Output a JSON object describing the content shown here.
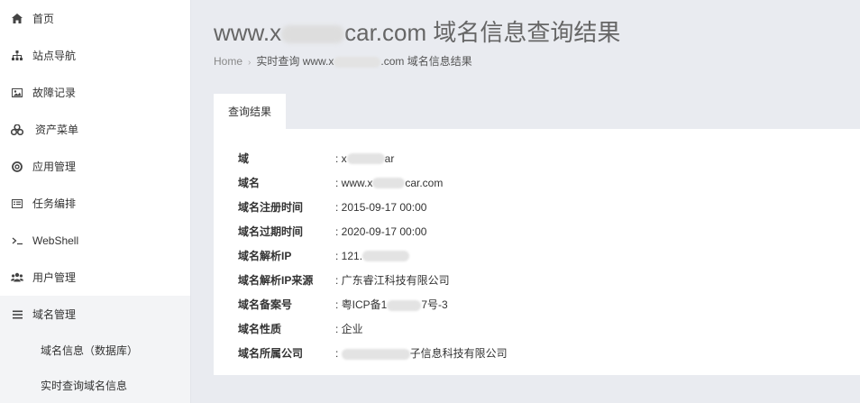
{
  "sidebar": {
    "items": [
      {
        "label": "首页",
        "icon": "home-icon"
      },
      {
        "label": "站点导航",
        "icon": "sitemap-icon"
      },
      {
        "label": "故障记录",
        "icon": "picture-icon"
      },
      {
        "label": "资产菜单",
        "icon": "cubes-icon"
      },
      {
        "label": "应用管理",
        "icon": "lifebuoy-icon"
      },
      {
        "label": "任务编排",
        "icon": "list-alt-icon"
      },
      {
        "label": "WebShell",
        "icon": "terminal-icon"
      },
      {
        "label": "用户管理",
        "icon": "users-icon"
      },
      {
        "label": "域名管理",
        "icon": "bars-icon"
      }
    ],
    "subitems": [
      {
        "label": "域名信息（数据库）"
      },
      {
        "label": "实时查询域名信息"
      }
    ]
  },
  "header": {
    "title_prefix": "www.x",
    "title_suffix": "car.com 域名信息查询结果"
  },
  "breadcrumb": {
    "home": "Home",
    "current_prefix": "实时查询 www.x",
    "current_suffix": ".com 域名信息结果"
  },
  "tabs": [
    {
      "label": "查询结果"
    }
  ],
  "result": [
    {
      "key": "域",
      "prefix": ": x",
      "suffix": "ar"
    },
    {
      "key": "域名",
      "prefix": ": www.x",
      "suffix": "car.com"
    },
    {
      "key": "域名注册时间",
      "prefix": ": 2015-09-17 00:00",
      "suffix": ""
    },
    {
      "key": "域名过期时间",
      "prefix": ": 2020-09-17 00:00",
      "suffix": ""
    },
    {
      "key": "域名解析IP",
      "prefix": ": 121.",
      "suffix": ""
    },
    {
      "key": "域名解析IP来源",
      "prefix": ": 广东睿江科技有限公司",
      "suffix": ""
    },
    {
      "key": "域名备案号",
      "prefix": ": 粤ICP备1",
      "suffix": "7号-3"
    },
    {
      "key": "域名性质",
      "prefix": ": 企业",
      "suffix": ""
    },
    {
      "key": "域名所属公司",
      "prefix": ": ",
      "suffix": "子信息科技有限公司"
    }
  ]
}
